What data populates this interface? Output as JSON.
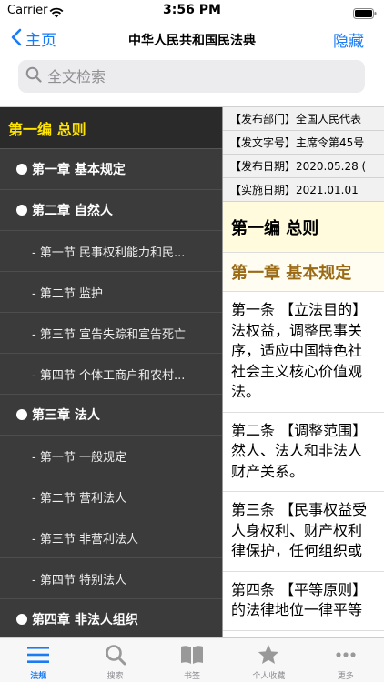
{
  "status": {
    "carrier": "Carrier",
    "time": "3:56 PM"
  },
  "nav": {
    "back_label": "主页",
    "title": "中华人民共和国民法典",
    "hide_label": "隐藏"
  },
  "search": {
    "placeholder": "全文检索",
    "value": ""
  },
  "toc": {
    "part": "第一编 总则",
    "chapters": [
      {
        "label": "第一章 基本规定",
        "sections": []
      },
      {
        "label": "第二章 自然人",
        "sections": [
          "- 第一节 民事权利能力和民...",
          "- 第二节 监护",
          "- 第三节 宣告失踪和宣告死亡",
          "- 第四节 个体工商户和农村..."
        ]
      },
      {
        "label": "第三章 法人",
        "sections": [
          "- 第一节 一般规定",
          "- 第二节 营利法人",
          "- 第三节 非营利法人",
          "- 第四节 特别法人"
        ]
      },
      {
        "label": "第四章 非法人组织",
        "sections": []
      }
    ]
  },
  "content": {
    "meta": [
      "【发布部门】全国人民代表",
      "【发文字号】主席令第45号",
      "【发布日期】2020.05.28 (",
      "【实施日期】2021.01.01"
    ],
    "part_title": "第一编 总则",
    "chapter_title": "第一章 基本规定",
    "articles": [
      [
        "第一条 【立法目的】",
        "法权益，调整民事关",
        "序，适应中国特色社",
        "社会主义核心价值观",
        "法。"
      ],
      [
        "第二条 【调整范围】",
        "然人、法人和非法人",
        "财产关系。"
      ],
      [
        "第三条 【民事权益受",
        "人身权利、财产权利",
        "律保护，任何组织或"
      ],
      [
        "第四条 【平等原则】",
        "的法律地位一律平等"
      ]
    ]
  },
  "tabs": [
    {
      "label": "法规",
      "icon": "list-icon",
      "active": true
    },
    {
      "label": "搜索",
      "icon": "search-icon",
      "active": false
    },
    {
      "label": "书签",
      "icon": "book-icon",
      "active": false
    },
    {
      "label": "个人收藏",
      "icon": "star-icon",
      "active": false
    },
    {
      "label": "更多",
      "icon": "more-icon",
      "active": false
    }
  ],
  "colors": {
    "accent": "#1a7cf5",
    "sidebar_bg": "#3b3b3b",
    "part_yellow": "#ffe400",
    "chapter_brown": "#9b6a14"
  }
}
